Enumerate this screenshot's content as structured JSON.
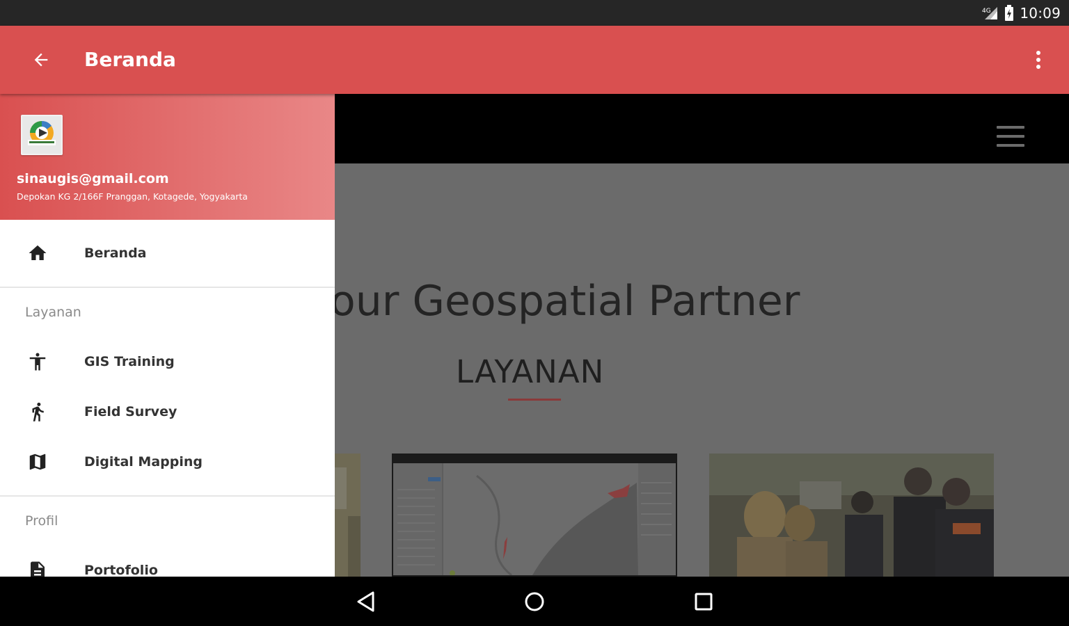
{
  "status_bar": {
    "time": "10:09"
  },
  "toolbar": {
    "title": "Beranda",
    "back_icon": "arrow-back-icon",
    "menu_icon": "more-vert-icon"
  },
  "drawer": {
    "email": "sinaugis@gmail.com",
    "address": "Depokan KG 2/166F Pranggan, Kotagede, Yogyakarta",
    "home_item": {
      "label": "Beranda",
      "icon": "home-icon"
    },
    "layanan_header": "Layanan",
    "layanan_items": [
      {
        "label": "GIS Training",
        "icon": "accessibility-icon"
      },
      {
        "label": "Field Survey",
        "icon": "walk-icon"
      },
      {
        "label": "Digital Mapping",
        "icon": "map-icon"
      }
    ],
    "profil_header": "Profil",
    "profil_items": [
      {
        "label": "Portofolio",
        "icon": "document-icon"
      }
    ]
  },
  "web": {
    "hero_text": "our Geospatial Partner",
    "section_title": "LAYANAN"
  },
  "colors": {
    "primary": "#d95050",
    "scrim": "#6b6b6b"
  }
}
